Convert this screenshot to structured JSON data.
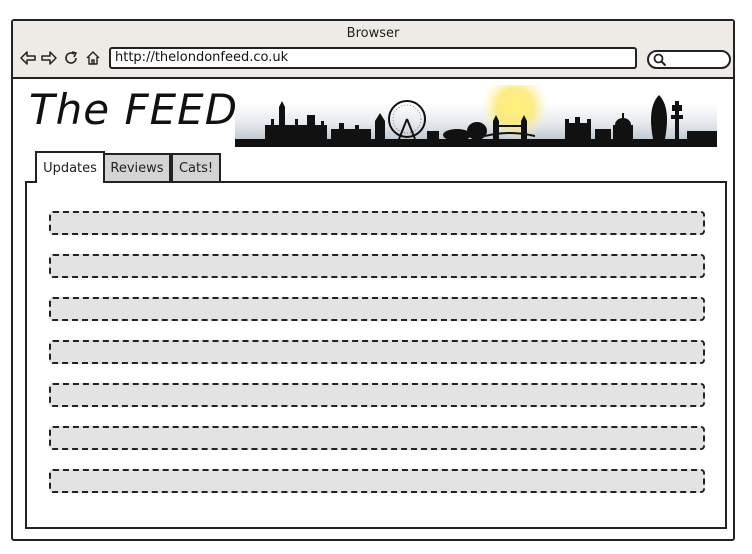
{
  "window": {
    "title": "Browser"
  },
  "nav": {
    "back_icon": "back-arrow-icon",
    "forward_icon": "forward-arrow-icon",
    "refresh_icon": "refresh-icon",
    "home_icon": "home-icon"
  },
  "address_bar": {
    "url": "http://thelondonfeed.co.uk"
  },
  "search": {
    "icon": "search-icon",
    "value": ""
  },
  "site": {
    "logo_text": "The FEED"
  },
  "tabs": [
    {
      "label": "Updates",
      "active": true
    },
    {
      "label": "Reviews",
      "active": false
    },
    {
      "label": "Cats!",
      "active": false
    }
  ],
  "feed": {
    "item_count_visible": 7
  }
}
